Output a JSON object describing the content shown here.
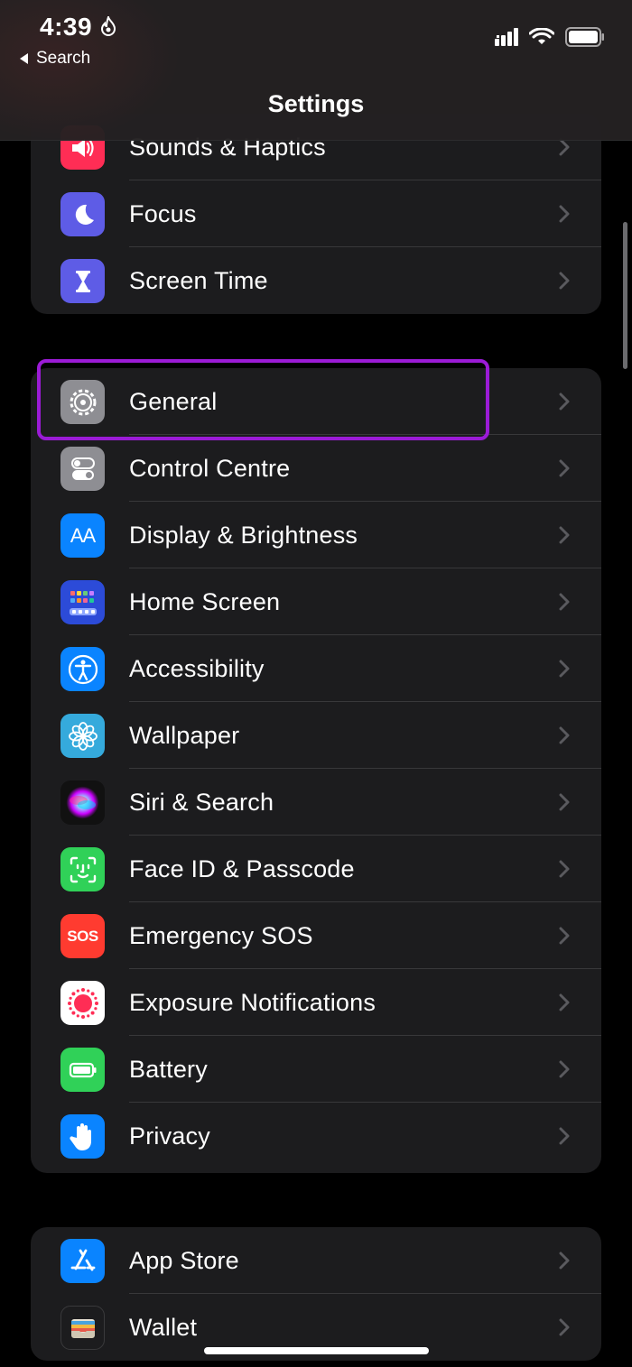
{
  "status_bar": {
    "time": "4:39",
    "back_label": "Search"
  },
  "nav": {
    "title": "Settings"
  },
  "groups": [
    {
      "items": [
        {
          "label": "Sounds & Haptics",
          "icon": "speaker-icon",
          "color": "#ff2d55"
        },
        {
          "label": "Focus",
          "icon": "moon-icon",
          "color": "#5e5ce6"
        },
        {
          "label": "Screen Time",
          "icon": "hourglass-icon",
          "color": "#5e5ce6"
        }
      ]
    },
    {
      "items": [
        {
          "label": "General",
          "icon": "gear-icon",
          "color": "#8e8e93"
        },
        {
          "label": "Control Centre",
          "icon": "toggles-icon",
          "color": "#8e8e93"
        },
        {
          "label": "Display & Brightness",
          "icon": "text-size-icon",
          "color": "#0a84ff",
          "icon_text": "AA"
        },
        {
          "label": "Home Screen",
          "icon": "home-grid-icon",
          "color": "#2c4bd8"
        },
        {
          "label": "Accessibility",
          "icon": "accessibility-icon",
          "color": "#0a84ff"
        },
        {
          "label": "Wallpaper",
          "icon": "flower-icon",
          "color": "#35aadc"
        },
        {
          "label": "Siri & Search",
          "icon": "siri-icon",
          "color": "#111111"
        },
        {
          "label": "Face ID & Passcode",
          "icon": "face-id-icon",
          "color": "#30d158"
        },
        {
          "label": "Emergency SOS",
          "icon": "sos-icon",
          "color": "#ff3b30",
          "icon_text": "SOS"
        },
        {
          "label": "Exposure Notifications",
          "icon": "exposure-icon",
          "color": "#ffffff"
        },
        {
          "label": "Battery",
          "icon": "battery-icon",
          "color": "#30d158"
        },
        {
          "label": "Privacy",
          "icon": "hand-icon",
          "color": "#0a84ff"
        }
      ]
    },
    {
      "items": [
        {
          "label": "App Store",
          "icon": "app-store-icon",
          "color": "#0a84ff"
        },
        {
          "label": "Wallet",
          "icon": "wallet-icon",
          "color": "#1c1c1e"
        }
      ]
    }
  ],
  "highlight_color": "#9b1bd6"
}
